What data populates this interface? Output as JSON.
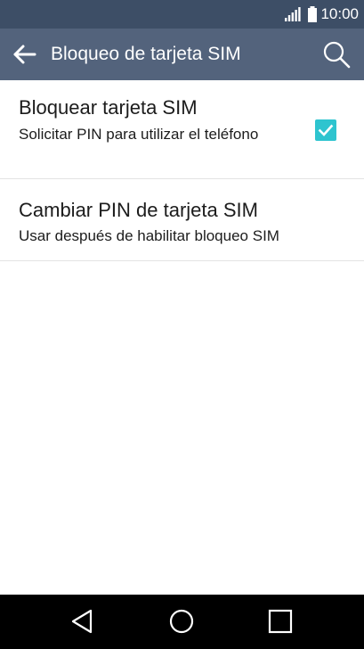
{
  "status_bar": {
    "time": "10:00",
    "icons": [
      "signal-icon",
      "battery-icon"
    ]
  },
  "app_bar": {
    "title": "Bloqueo de tarjeta SIM",
    "back_icon": "arrow-left-icon",
    "search_icon": "search-icon"
  },
  "preferences": [
    {
      "title": "Bloquear tarjeta SIM",
      "summary": "Solicitar PIN para utilizar el teléfono",
      "checked": true
    },
    {
      "title": "Cambiar PIN de tarjeta SIM",
      "summary": "Usar después de habilitar bloqueo SIM"
    }
  ],
  "nav_bar": {
    "icons": [
      "back-triangle-icon",
      "home-circle-icon",
      "recents-square-icon"
    ]
  },
  "colors": {
    "status_bar": "#3d4e66",
    "app_bar": "#53637c",
    "checkbox": "#2ec4cf",
    "nav_bar": "#000000"
  }
}
